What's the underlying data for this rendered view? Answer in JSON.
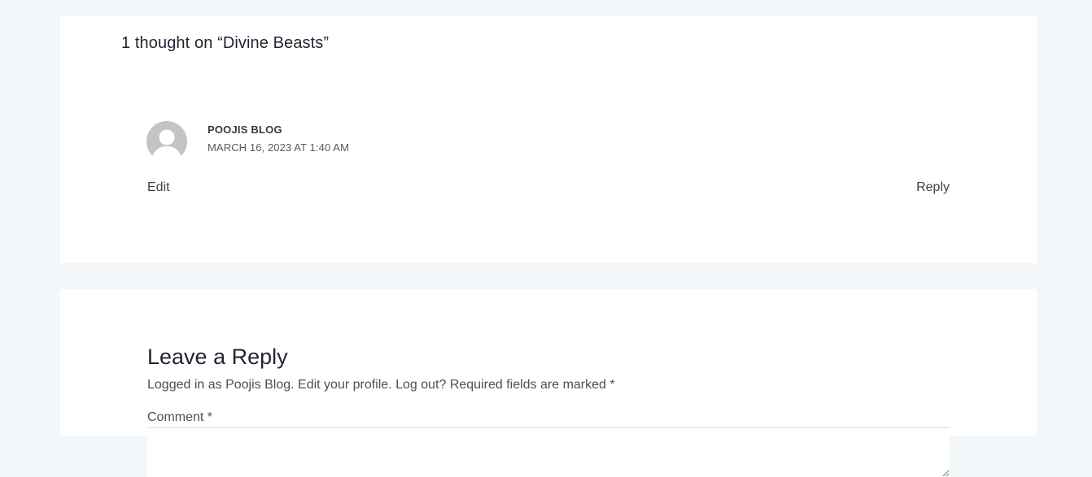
{
  "comments": {
    "title": "1 thought on “Divine Beasts”",
    "items": [
      {
        "author": "POOJIS BLOG",
        "date": "MARCH 16, 2023 AT 1:40 AM",
        "edit_label": "Edit",
        "reply_label": "Reply",
        "avatar_icon": "default-user-avatar-icon"
      }
    ]
  },
  "reply_form": {
    "title": "Leave a Reply",
    "logged_in_as": "Logged in as Poojis Blog.",
    "edit_profile": "Edit your profile.",
    "log_out": "Log out?",
    "required_note": "Required fields are marked",
    "required_mark": "*",
    "comment_label": "Comment *",
    "comment_value": ""
  },
  "colors": {
    "page_background": "#f3f7fa",
    "card_background": "#ffffff",
    "heading_text": "#1f2530",
    "body_text": "#4a4f56",
    "avatar_gray": "#c4c4c4"
  }
}
